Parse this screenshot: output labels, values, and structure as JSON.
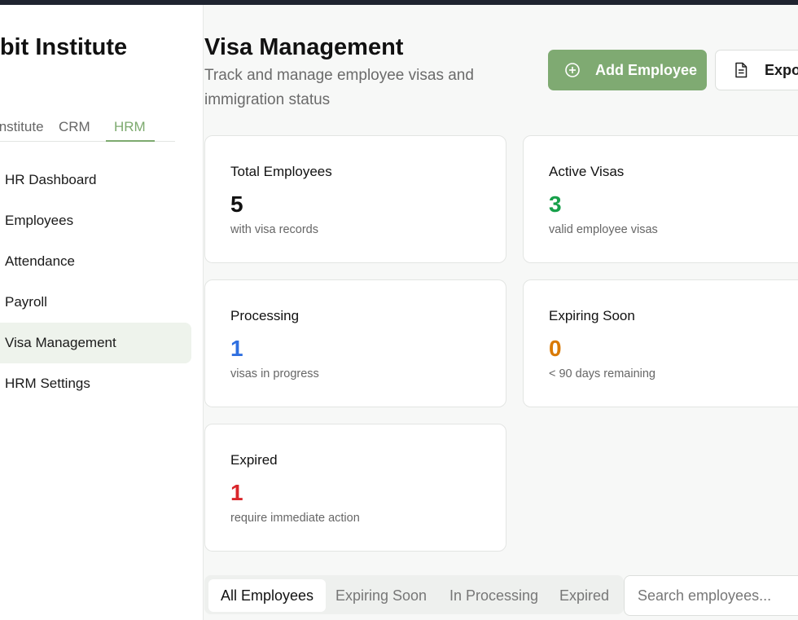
{
  "sidebar": {
    "brand": "Orbit Institute",
    "tabs": [
      "Institute",
      "CRM",
      "HRM"
    ],
    "active_tab": "HRM",
    "items": [
      {
        "label": "HR Dashboard"
      },
      {
        "label": "Employees"
      },
      {
        "label": "Attendance"
      },
      {
        "label": "Payroll"
      },
      {
        "label": "Visa Management"
      },
      {
        "label": "HRM Settings"
      }
    ],
    "active_item": "Visa Management"
  },
  "header": {
    "title": "Visa Management",
    "subtitle": "Track and manage employee visas and immigration status",
    "add_label": "Add Employee",
    "export_label": "Export"
  },
  "stats": [
    {
      "label": "Total Employees",
      "value": "5",
      "note": "with visa records",
      "color": "#111111"
    },
    {
      "label": "Active Visas",
      "value": "3",
      "note": "valid employee visas",
      "color": "#17a04a"
    },
    {
      "label": "Processing",
      "value": "1",
      "note": "visas in progress",
      "color": "#2f6fe0"
    },
    {
      "label": "Expiring Soon",
      "value": "0",
      "note": "< 90 days remaining",
      "color": "#d97a06"
    },
    {
      "label": "Expired",
      "value": "1",
      "note": "require immediate action",
      "color": "#d9262b"
    }
  ],
  "filters": {
    "tabs": [
      "All Employees",
      "Expiring Soon",
      "In Processing",
      "Expired"
    ],
    "active": "All Employees",
    "search_placeholder": "Search employees..."
  },
  "colors": {
    "accent": "#7faa72",
    "topbar": "#1f2430"
  }
}
